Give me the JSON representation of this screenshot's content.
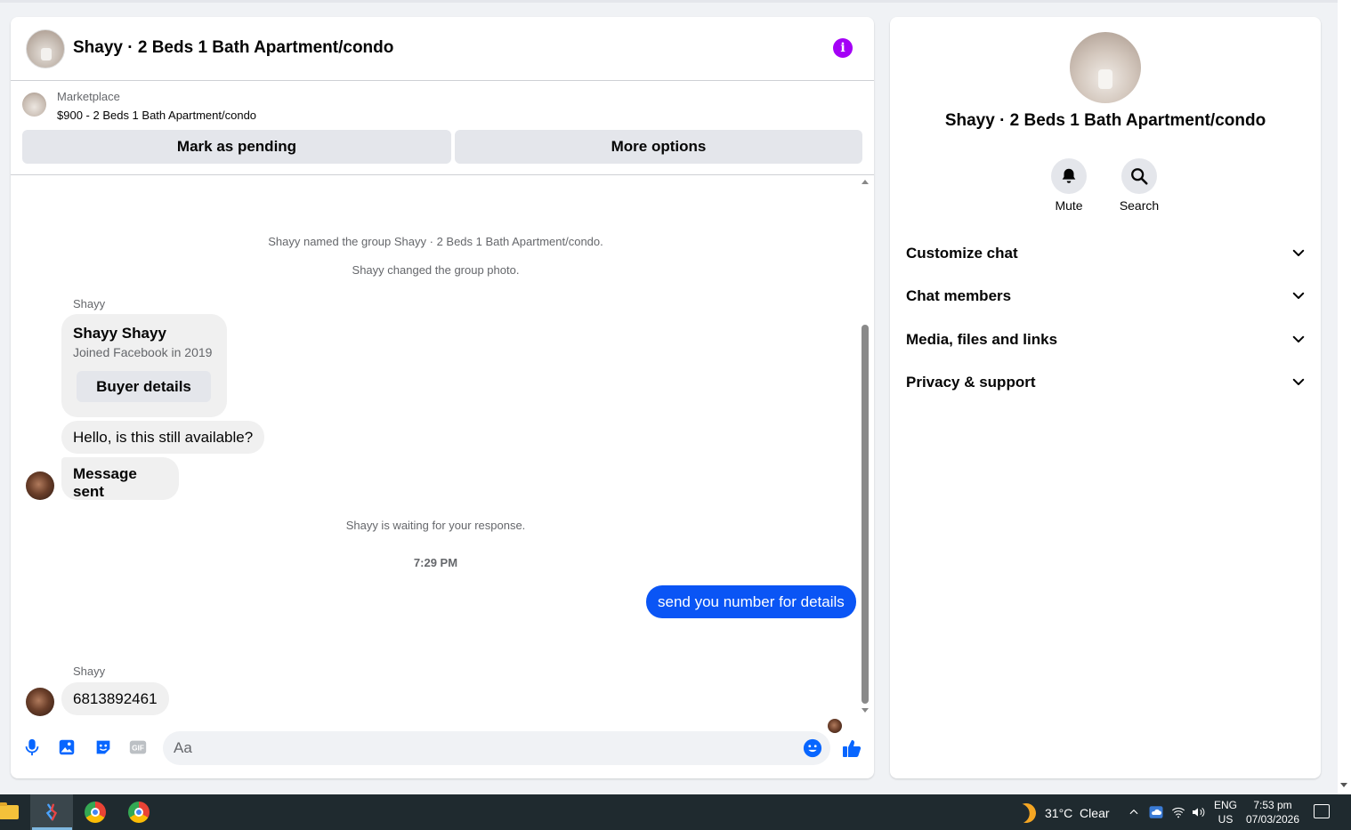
{
  "chat": {
    "title": "Shayy · 2 Beds 1 Bath Apartment/condo",
    "marketplace": {
      "label": "Marketplace",
      "listing": "$900 - 2 Beds 1 Bath Apartment/condo",
      "mark_pending": "Mark as pending",
      "more_options": "More options"
    },
    "events": {
      "named": "Shayy named the group Shayy · 2 Beds 1 Bath Apartment/condo.",
      "photo": "Shayy changed the group photo.",
      "waiting": "Shayy is waiting for your response.",
      "time": "7:29 PM"
    },
    "messages": {
      "sender_1": "Shayy",
      "buyer_name": "Shayy Shayy",
      "buyer_joined": "Joined Facebook in 2019",
      "buyer_details": "Buyer details",
      "hello": "Hello, is this still available?",
      "sent": "Message sent",
      "mine": "send you number for details",
      "sender_2": "Shayy",
      "phone": "6813892461"
    },
    "composer": {
      "placeholder": "Aa"
    },
    "colors": {
      "accent": "#0a55f5",
      "info": "#a400f6",
      "icon": "#0866ff"
    }
  },
  "info_panel": {
    "title": "Shayy · 2 Beds 1 Bath Apartment/condo",
    "mute": "Mute",
    "search": "Search",
    "sections": [
      "Customize chat",
      "Chat members",
      "Media, files and links",
      "Privacy & support"
    ]
  },
  "taskbar": {
    "weather": "31°C  Clear",
    "lang_1": "ENG",
    "lang_2": "US",
    "time": "7:53 pm",
    "date": "07/03/2026"
  }
}
